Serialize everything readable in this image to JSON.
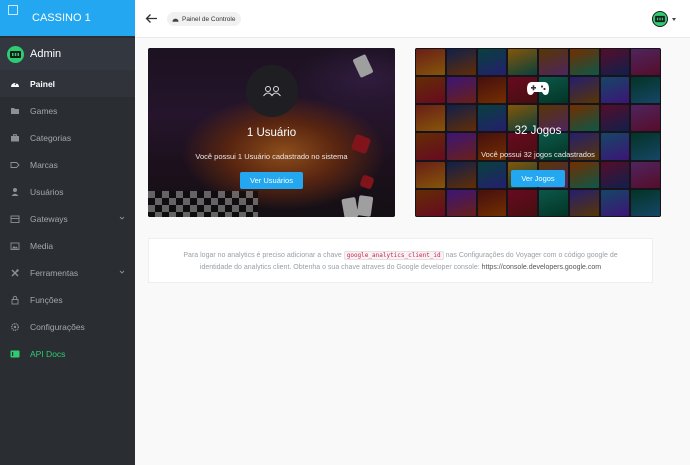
{
  "sidebar": {
    "brand": "CASSINO 1",
    "admin_name": "Admin",
    "items": [
      {
        "label": "Painel",
        "icon": "dashboard-icon",
        "active": true
      },
      {
        "label": "Games",
        "icon": "folder-icon"
      },
      {
        "label": "Categorias",
        "icon": "briefcase-icon"
      },
      {
        "label": "Marcas",
        "icon": "tag-icon"
      },
      {
        "label": "Usuários",
        "icon": "person-icon"
      },
      {
        "label": "Gateways",
        "icon": "boxes-icon",
        "expandable": true
      },
      {
        "label": "Media",
        "icon": "image-icon"
      },
      {
        "label": "Ferramentas",
        "icon": "tools-icon",
        "expandable": true
      },
      {
        "label": "Funções",
        "icon": "lock-icon"
      },
      {
        "label": "Configurações",
        "icon": "gear-icon"
      },
      {
        "label": "API Docs",
        "icon": "api-docs-icon"
      }
    ]
  },
  "topbar": {
    "breadcrumb": "Painel de Controle"
  },
  "cards": {
    "users": {
      "title": "1 Usuário",
      "description": "Você possui 1 Usuário cadastrado no sistema",
      "button": "Ver Usuários"
    },
    "games": {
      "title": "32 Jogos",
      "description": "Você possui 32 jogos cadastrados",
      "button": "Ver Jogos"
    }
  },
  "notice": {
    "before_code": "Para logar no analytics é preciso adicionar a chave",
    "code": "google_analytics_client_id",
    "after_code": "nas Configurações do Voyager com o código google de identidade do analytics client. Obtenha o sua chave atraves do Google developer console:",
    "link": "https://console.developers.google.com"
  },
  "colors": {
    "accent": "#22a7f0",
    "sidebar_bg": "#2a2e33",
    "api_green": "#2ecc71"
  }
}
